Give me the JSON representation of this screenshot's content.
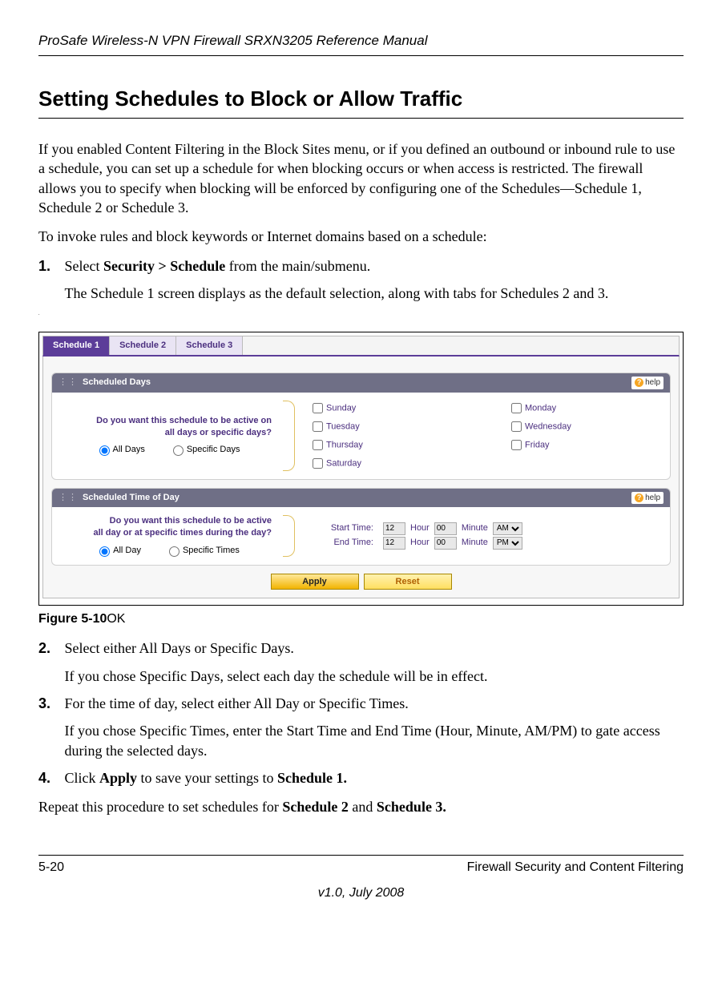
{
  "doc": {
    "header": "ProSafe Wireless-N VPN Firewall SRXN3205 Reference Manual",
    "section_heading": "Setting Schedules to Block or Allow Traffic",
    "p1": "If you enabled Content Filtering in the Block Sites menu, or if you defined an outbound or inbound rule to use a schedule, you can set up a schedule for when blocking occurs or when access is restricted. The firewall allows you to specify when blocking will be enforced by configuring one of the Schedules—Schedule 1, Schedule 2 or Schedule 3.",
    "p2": "To invoke rules and block keywords or Internet domains based on a schedule:",
    "steps": {
      "s1a_prefix": "Select ",
      "s1a_bold": "Security > Schedule",
      "s1a_suffix": " from the main/submenu.",
      "s1b": "The Schedule 1 screen displays as the default selection, along with tabs for Schedules 2 and 3.",
      "s2a": "Select either All Days or Specific Days.",
      "s2b": "If you chose Specific Days, select each day the schedule will be in effect.",
      "s3a": "For the time of day, select either All Day or Specific Times.",
      "s3b": "If you chose Specific Times, enter the Start Time and End Time (Hour, Minute, AM/PM) to gate access during the selected days.",
      "s4_prefix": "Click ",
      "s4_bold1": "Apply",
      "s4_mid": " to save your settings to ",
      "s4_bold2": "Schedule 1."
    },
    "closing_prefix": "Repeat this procedure to set schedules for ",
    "closing_b1": "Schedule 2",
    "closing_mid": " and ",
    "closing_b2": "Schedule 3.",
    "fig_label_bold": "Figure 5-10",
    "fig_label_rest": "OK"
  },
  "shot": {
    "tabs": {
      "t1": "Schedule 1",
      "t2": "Schedule 2",
      "t3": "Schedule 3"
    },
    "help": "help",
    "days": {
      "title": "Scheduled Days",
      "q1": "Do you want this schedule to be active on",
      "q2": "all days or specific days?",
      "r_all": "All Days",
      "r_spec": "Specific Days",
      "sun": "Sunday",
      "mon": "Monday",
      "tue": "Tuesday",
      "wed": "Wednesday",
      "thu": "Thursday",
      "fri": "Friday",
      "sat": "Saturday"
    },
    "time": {
      "title": "Scheduled Time of Day",
      "q1": "Do you want this schedule to be active",
      "q2": "all day or at specific times during the day?",
      "r_all": "All Day",
      "r_spec": "Specific Times",
      "start_lbl": "Start Time:",
      "end_lbl": "End Time:",
      "hour_word": "Hour",
      "min_word": "Minute",
      "start_h": "12",
      "start_m": "00",
      "start_ampm": "AM",
      "end_h": "12",
      "end_m": "00",
      "end_ampm": "PM"
    },
    "btn_apply": "Apply",
    "btn_reset": "Reset"
  },
  "footer": {
    "page": "5-20",
    "section": "Firewall Security and Content Filtering",
    "version": "v1.0, July 2008"
  }
}
